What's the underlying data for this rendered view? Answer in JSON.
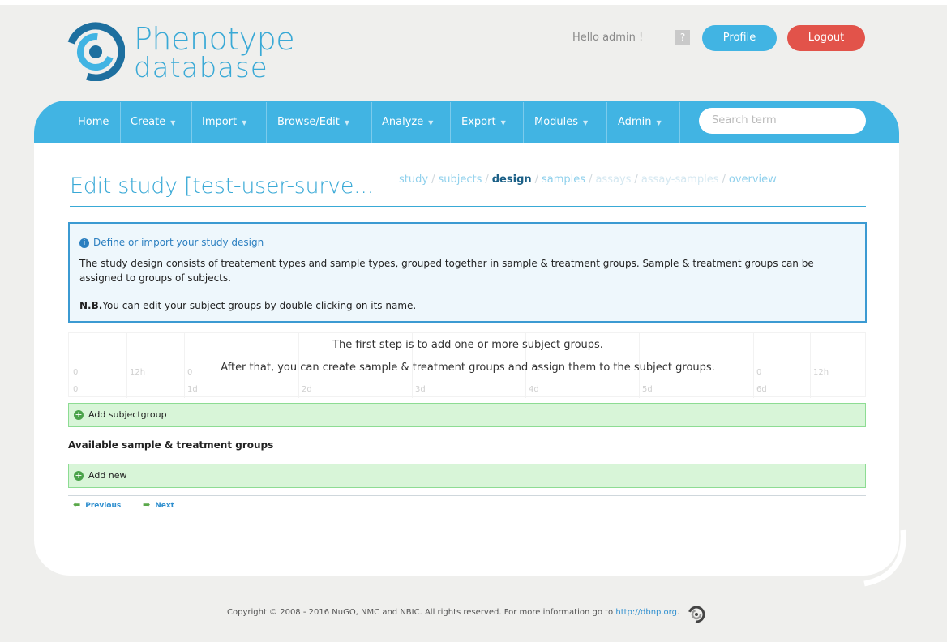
{
  "logo": {
    "line1": "Phenotype",
    "line2": "database"
  },
  "user": {
    "greeting": "Hello admin !",
    "help": "?",
    "profile_label": "Profile",
    "logout_label": "Logout"
  },
  "nav": {
    "items": [
      {
        "label": "Home",
        "dropdown": false
      },
      {
        "label": "Create",
        "dropdown": true
      },
      {
        "label": "Import",
        "dropdown": true
      },
      {
        "label": "Browse/Edit",
        "dropdown": true
      },
      {
        "label": "Analyze",
        "dropdown": true
      },
      {
        "label": "Export",
        "dropdown": true
      },
      {
        "label": "Modules",
        "dropdown": true
      },
      {
        "label": "Admin",
        "dropdown": true
      }
    ],
    "search_placeholder": "Search term"
  },
  "page": {
    "title": "Edit study [test-user-surve..."
  },
  "breadcrumb": {
    "study": "study",
    "subjects": "subjects",
    "design": "design",
    "samples": "samples",
    "assays": "assays",
    "assay_samples": "assay-samples",
    "overview": "overview",
    "sep": "/"
  },
  "info": {
    "heading": "Define or import your study design",
    "body": "The study design consists of treatement types and sample types, grouped together in sample & treatment groups. Sample & treatment groups can be assigned to groups of subjects.",
    "nb_label": "N.B.",
    "nb_text": "You can edit your subject groups by double clicking on its name."
  },
  "timeline": {
    "message1": "The first step is to add one or more subject groups.",
    "message2": "After that, you can create sample & treatment groups and assign them to the subject groups.",
    "top_labels": [
      "0",
      "12h",
      "0",
      "0",
      "12h"
    ],
    "bottom_labels": [
      "0",
      "1d",
      "2d",
      "3d",
      "4d",
      "5d",
      "6d"
    ]
  },
  "subjectgroup": {
    "add_label": "Add subjectgroup"
  },
  "groups": {
    "heading": "Available sample & treatment groups",
    "add_label": "Add new"
  },
  "pager": {
    "previous": "Previous",
    "next": "Next"
  },
  "footer": {
    "text": "Copyright © 2008 - 2016 NuGO, NMC and NBIC. All rights reserved. For more information go to",
    "link": "http://dbnp.org",
    "after": "."
  },
  "colors": {
    "brand_blue": "#41b4e3",
    "logout_red": "#e2534a",
    "green_bar": "#d8f5d8"
  }
}
